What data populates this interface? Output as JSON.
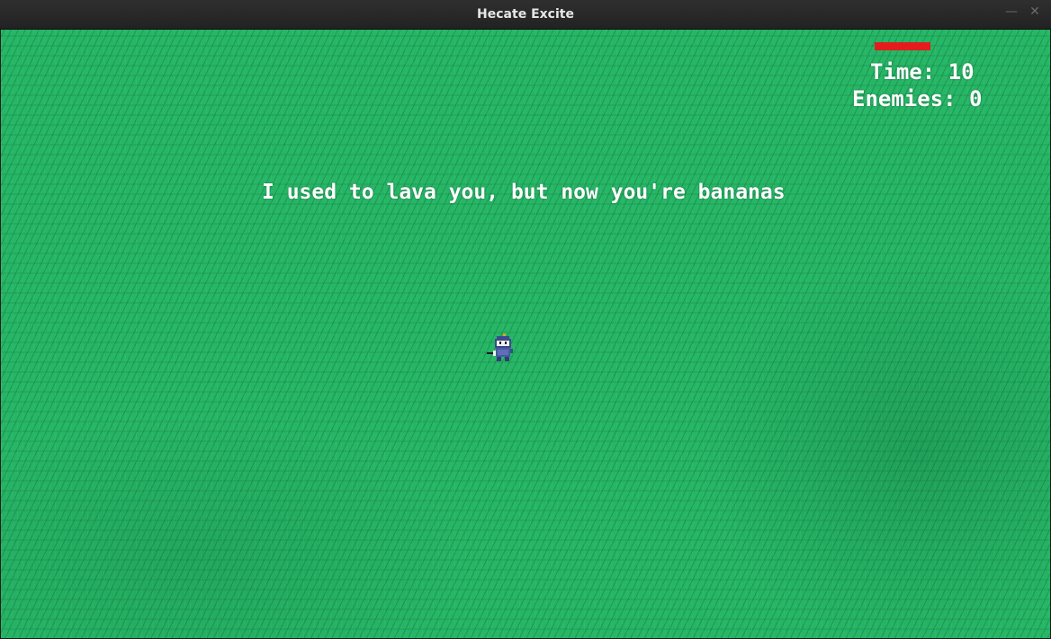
{
  "window": {
    "title": "Hecate Excite",
    "minimize_glyph": "—",
    "close_glyph": "✕"
  },
  "game": {
    "background_color": "#27b566",
    "health_fraction": 1.0,
    "health_color": "#e51c1c",
    "hud": {
      "time_text": "Time: 10",
      "enemies_text": "Enemies: 0"
    },
    "message": "I used to lava you, but now you're bananas",
    "player_icon": "knight-sprite-icon"
  }
}
